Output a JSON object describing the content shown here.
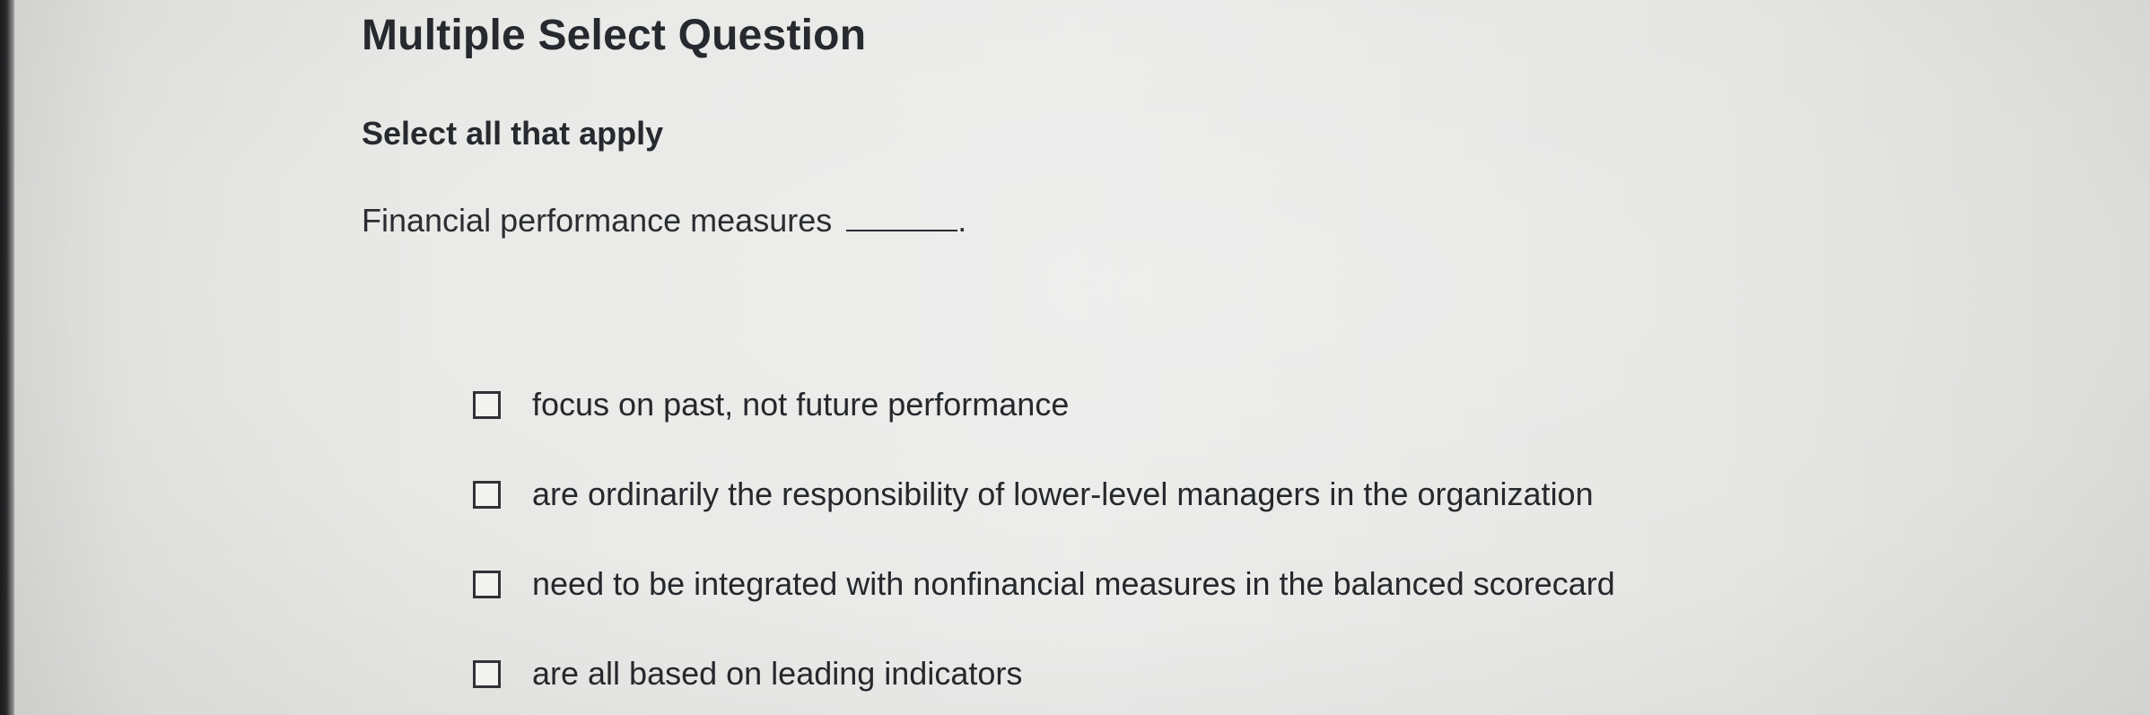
{
  "question": {
    "type_label": "Multiple Select Question",
    "instruction": "Select all that apply",
    "prompt": "Financial performance measures",
    "prompt_suffix": "."
  },
  "options": [
    {
      "label": "focus on past, not future performance",
      "checked": false
    },
    {
      "label": "are ordinarily the responsibility of lower-level managers in the organization",
      "checked": false
    },
    {
      "label": "need to be integrated with nonfinancial measures in the balanced scorecard",
      "checked": false
    },
    {
      "label": "are all based on leading indicators",
      "checked": false
    }
  ]
}
